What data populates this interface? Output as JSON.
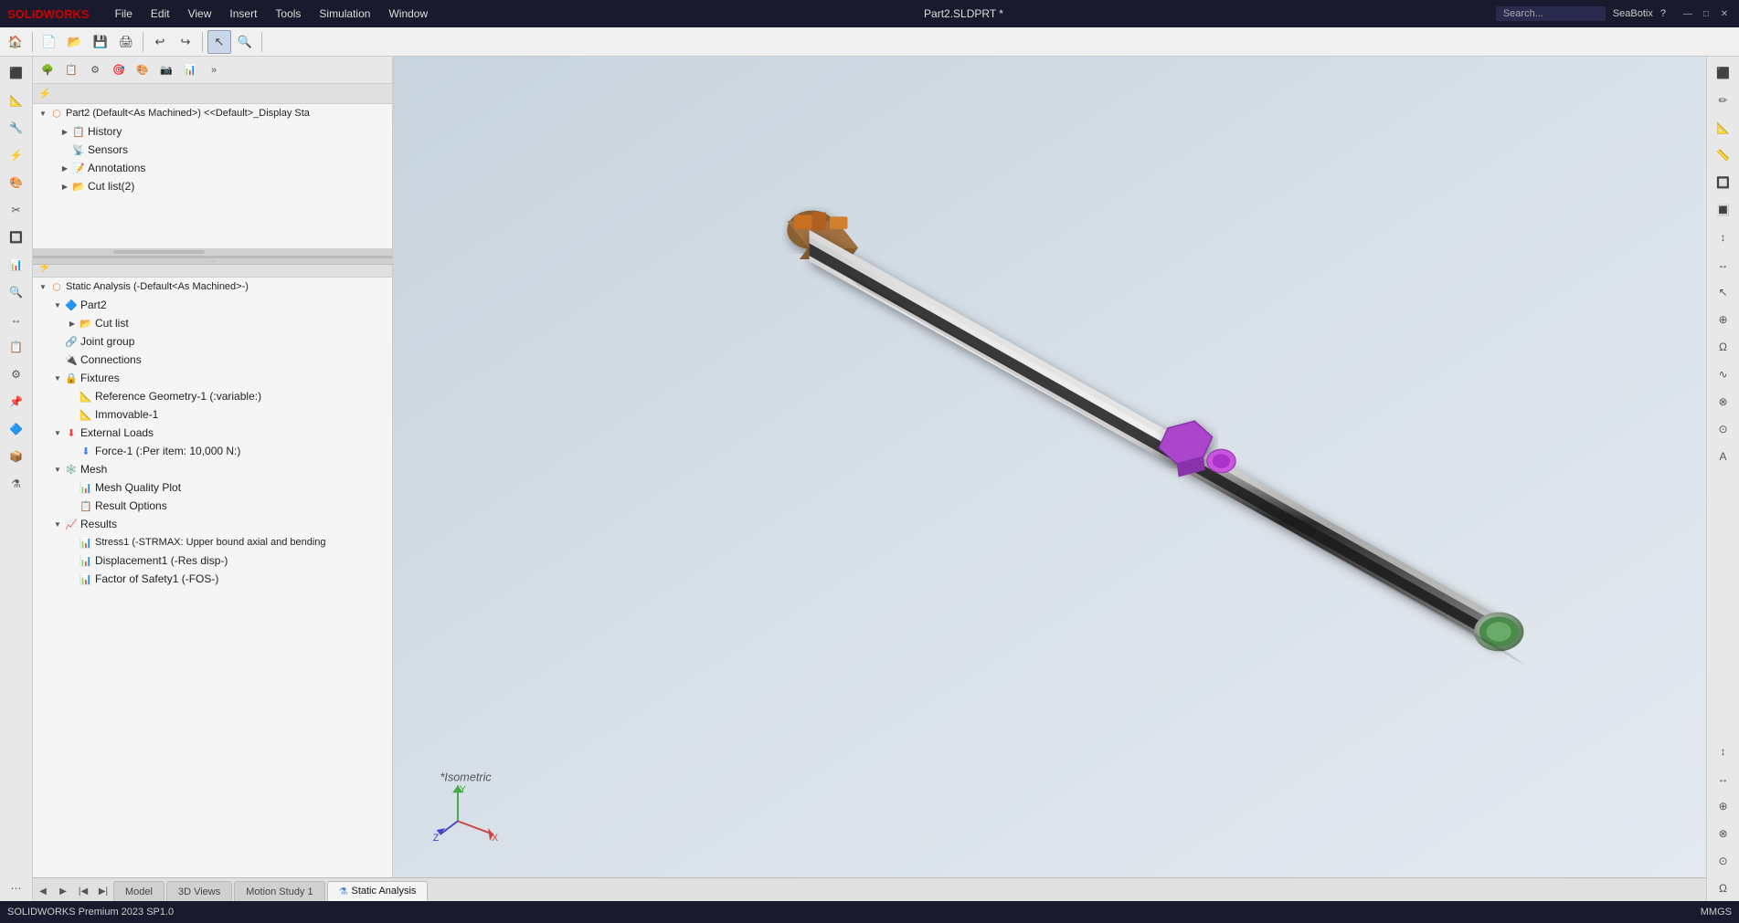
{
  "app": {
    "title": "Part2.SLDPRT *",
    "software": "SOLIDWORKS",
    "version": "SOLIDWORKS Premium 2023 SP1.0",
    "user": "SeaBotix",
    "units": "MMGS"
  },
  "menu": {
    "items": [
      "File",
      "Edit",
      "View",
      "Insert",
      "Tools",
      "Simulation",
      "Window"
    ]
  },
  "feature_tree": {
    "root_label": "Part2 (Default<As Machined>) <<Default>_Display Sta",
    "items": [
      {
        "id": "history",
        "label": "History",
        "level": 1,
        "has_arrow": true,
        "icon": "📋"
      },
      {
        "id": "sensors",
        "label": "Sensors",
        "level": 1,
        "has_arrow": false,
        "icon": "📡"
      },
      {
        "id": "annotations",
        "label": "Annotations",
        "level": 1,
        "has_arrow": true,
        "icon": "📝"
      },
      {
        "id": "cut-list",
        "label": "Cut list(2)",
        "level": 1,
        "has_arrow": true,
        "icon": "📂"
      }
    ]
  },
  "sim_tree": {
    "root_label": "Static Analysis (-Default<As Machined>-)",
    "items": [
      {
        "id": "part2",
        "label": "Part2",
        "level": 1,
        "has_arrow": true,
        "icon": "🔷"
      },
      {
        "id": "cut-list-sim",
        "label": "Cut list",
        "level": 2,
        "has_arrow": true,
        "icon": "📂"
      },
      {
        "id": "joint-group",
        "label": "Joint group",
        "level": 1,
        "has_arrow": false,
        "icon": "🔗"
      },
      {
        "id": "connections",
        "label": "Connections",
        "level": 1,
        "has_arrow": false,
        "icon": "🔌"
      },
      {
        "id": "fixtures",
        "label": "Fixtures",
        "level": 1,
        "has_arrow": true,
        "icon": "🔒",
        "expanded": true
      },
      {
        "id": "ref-geo",
        "label": "Reference Geometry-1 (:variable:)",
        "level": 2,
        "has_arrow": false,
        "icon": "📐"
      },
      {
        "id": "immovable",
        "label": "Immovable-1",
        "level": 2,
        "has_arrow": false,
        "icon": "📐"
      },
      {
        "id": "ext-loads",
        "label": "External Loads",
        "level": 1,
        "has_arrow": true,
        "icon": "⬇",
        "expanded": true
      },
      {
        "id": "force1",
        "label": "Force-1 (:Per item: 10,000 N:)",
        "level": 2,
        "has_arrow": false,
        "icon": "⬇"
      },
      {
        "id": "mesh",
        "label": "Mesh",
        "level": 1,
        "has_arrow": true,
        "icon": "🕸",
        "expanded": true
      },
      {
        "id": "mesh-quality",
        "label": "Mesh Quality Plot",
        "level": 2,
        "has_arrow": false,
        "icon": "📊"
      },
      {
        "id": "result-options",
        "label": "Result Options",
        "level": 2,
        "has_arrow": false,
        "icon": "📋"
      },
      {
        "id": "results",
        "label": "Results",
        "level": 1,
        "has_arrow": true,
        "icon": "📈",
        "expanded": true
      },
      {
        "id": "stress1",
        "label": "Stress1 (-STRMAX: Upper bound axial and bending",
        "level": 2,
        "has_arrow": false,
        "icon": "📊"
      },
      {
        "id": "displacement1",
        "label": "Displacement1 (-Res disp-)",
        "level": 2,
        "has_arrow": false,
        "icon": "📊"
      },
      {
        "id": "fos1",
        "label": "Factor of Safety1 (-FOS-)",
        "level": 2,
        "has_arrow": false,
        "icon": "📊"
      }
    ]
  },
  "tabs": [
    {
      "id": "model",
      "label": "Model",
      "active": false
    },
    {
      "id": "3d-views",
      "label": "3D Views",
      "active": false
    },
    {
      "id": "motion-study",
      "label": "Motion Study 1",
      "active": false
    },
    {
      "id": "static-analysis",
      "label": "Static Analysis",
      "active": true
    }
  ],
  "viewport": {
    "view_label": "*Isometric"
  },
  "icons": {
    "arrow_right": "▶",
    "arrow_down": "▼",
    "filter": "⚡",
    "search": "🔍",
    "minimize": "—",
    "maximize": "□",
    "close": "✕"
  }
}
